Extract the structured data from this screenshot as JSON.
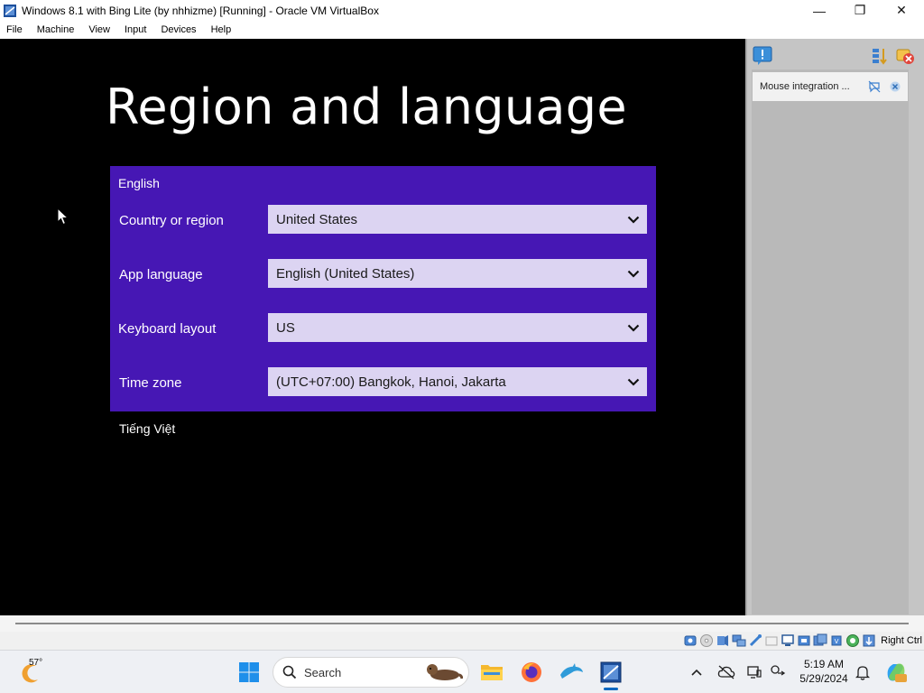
{
  "window": {
    "title": "Windows 8.1 with Bing Lite (by nhhizme) [Running] - Oracle VM VirtualBox",
    "controls": {
      "minimize": "—",
      "maximize": "❐",
      "close": "✕"
    }
  },
  "menu": [
    "File",
    "Machine",
    "View",
    "Input",
    "Devices",
    "Help"
  ],
  "guest": {
    "heading": "Region and language",
    "selected_language": "English",
    "fields": [
      {
        "label": "Country or region",
        "value": "United States"
      },
      {
        "label": "App language",
        "value": "English (United States)"
      },
      {
        "label": "Keyboard layout",
        "value": "US"
      },
      {
        "label": "Time zone",
        "value": "(UTC+07:00) Bangkok, Hanoi, Jakarta"
      }
    ],
    "other_language": "Tiếng Việt",
    "colors": {
      "background": "#000000",
      "panel": "#4617b4",
      "dropdown": "#dcd4f2"
    }
  },
  "notifications": {
    "item": "Mouse integration ..."
  },
  "statusbar": {
    "host_key": "Right Ctrl"
  },
  "taskbar": {
    "weather_temp": "57°",
    "search_placeholder": "Search",
    "apps": [
      "file-explorer",
      "firefox",
      "dolphin",
      "virtualbox"
    ],
    "time": "5:19 AM",
    "date": "5/29/2024"
  }
}
